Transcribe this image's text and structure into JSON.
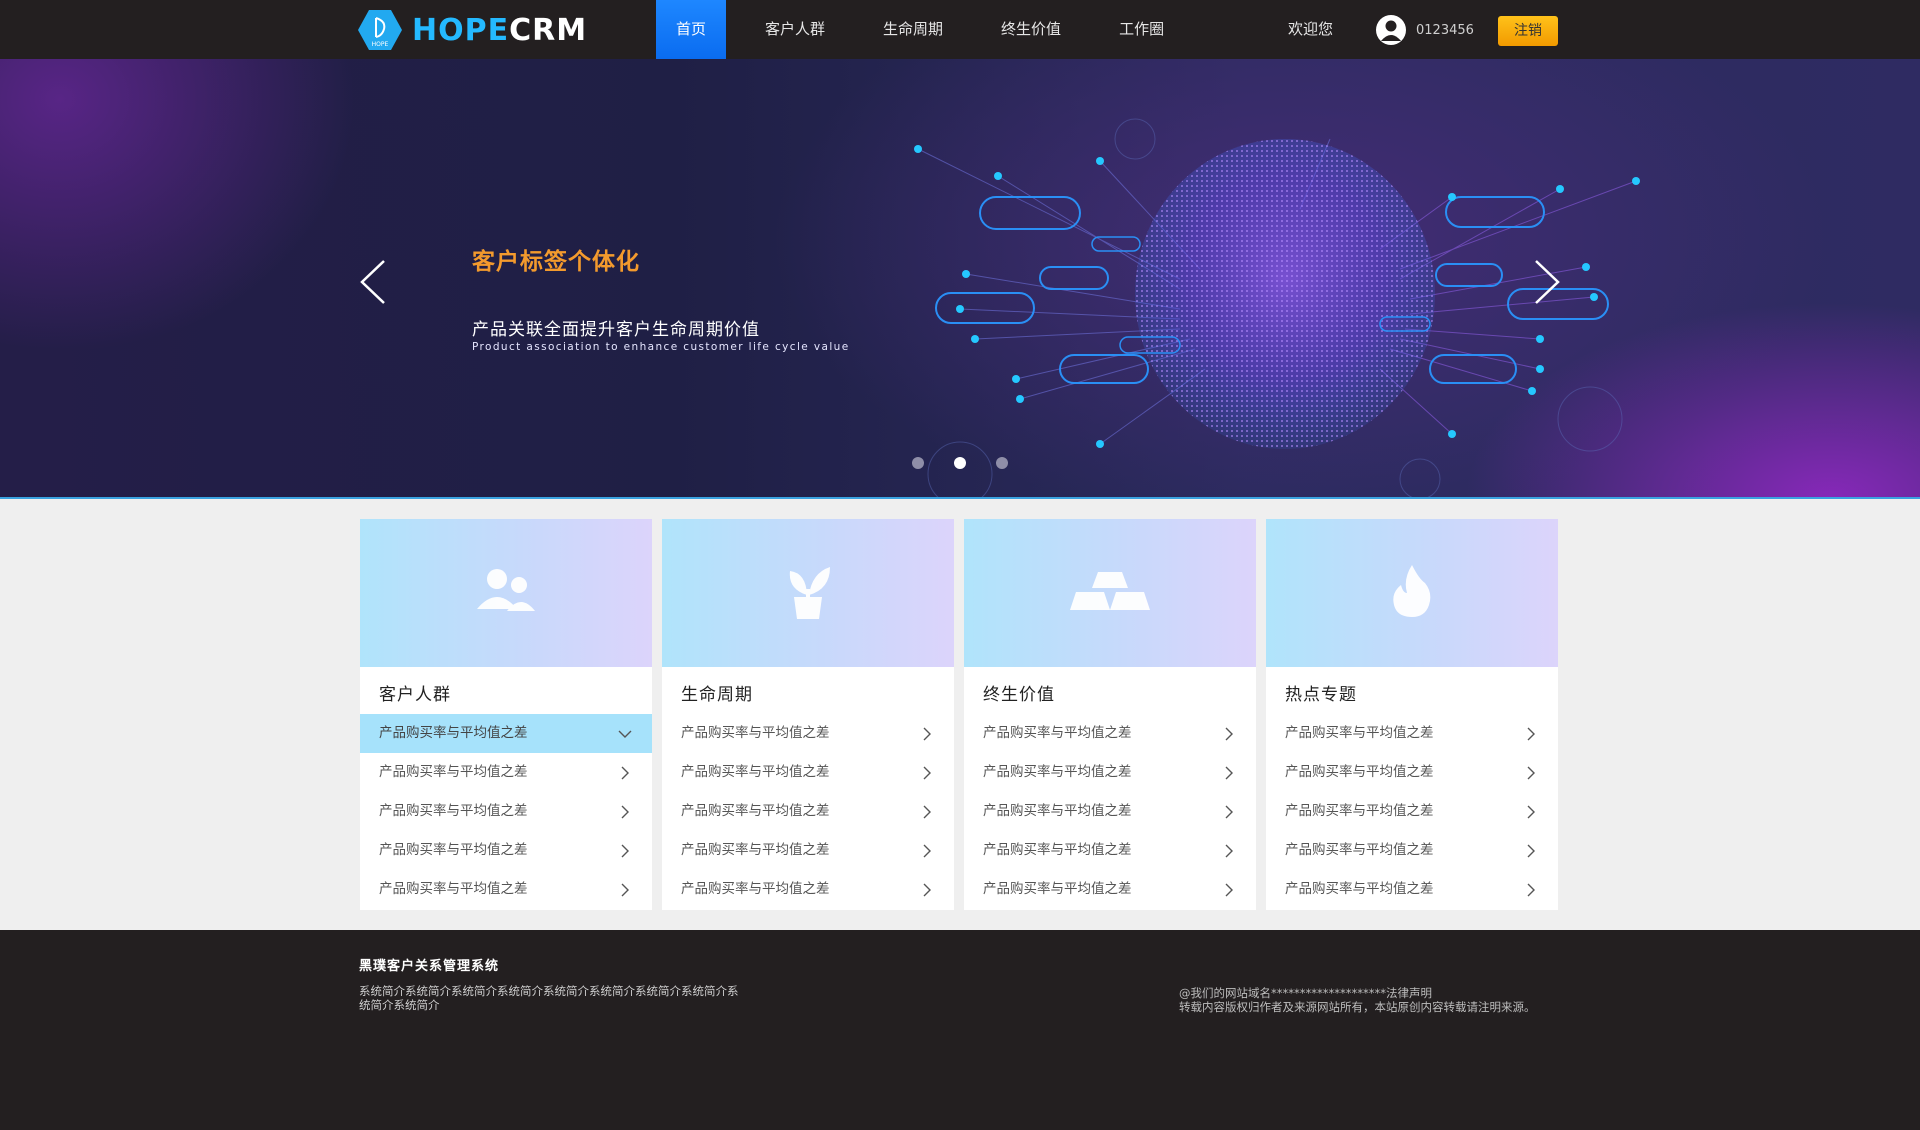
{
  "header": {
    "logo": {
      "hope": "HOPE",
      "crm": "CRM",
      "badge": "HOPE"
    },
    "nav": [
      "首页",
      "客户人群",
      "生命周期",
      "终生价值",
      "工作圈"
    ],
    "welcome": "欢迎您",
    "username": "0123456",
    "logout": "注销"
  },
  "banner": {
    "title": "客户标签个体化",
    "subtitle": "产品关联全面提升客户生命周期价值",
    "subtitle_en": "Product association to enhance customer life cycle value",
    "slide_count": 3,
    "active_slide": 2
  },
  "cards": [
    {
      "title": "客户人群",
      "icon": "users-icon",
      "items": [
        "产品购买率与平均值之差",
        "产品购买率与平均值之差",
        "产品购买率与平均值之差",
        "产品购买率与平均值之差",
        "产品购买率与平均值之差"
      ]
    },
    {
      "title": "生命周期",
      "icon": "sprout-icon",
      "items": [
        "产品购买率与平均值之差",
        "产品购买率与平均值之差",
        "产品购买率与平均值之差",
        "产品购买率与平均值之差",
        "产品购买率与平均值之差"
      ]
    },
    {
      "title": "终生价值",
      "icon": "gold-bars-icon",
      "items": [
        "产品购买率与平均值之差",
        "产品购买率与平均值之差",
        "产品购买率与平均值之差",
        "产品购买率与平均值之差",
        "产品购买率与平均值之差"
      ]
    },
    {
      "title": "热点专题",
      "icon": "flame-icon",
      "items": [
        "产品购买率与平均值之差",
        "产品购买率与平均值之差",
        "产品购买率与平均值之差",
        "产品购买率与平均值之差",
        "产品购买率与平均值之差"
      ]
    }
  ],
  "footer": {
    "title": "黑璞客户关系管理系统",
    "desc": "系统简介系统简介系统简介系统简介系统简介系统简介系统简介系统简介系统简介系统简介",
    "domain_line": "@我们的网站域名********************法律声明",
    "copyright": "转载内容版权归作者及来源网站所有，本站原创内容转载请注明来源。"
  },
  "colors": {
    "header_bg": "#231f20",
    "nav_active": "#1e87ff",
    "banner_title": "#f39a2d",
    "logout_bg": "#f7b10d",
    "card_active_row": "#a6e2fb",
    "logo_blue": "#24b9ff"
  }
}
